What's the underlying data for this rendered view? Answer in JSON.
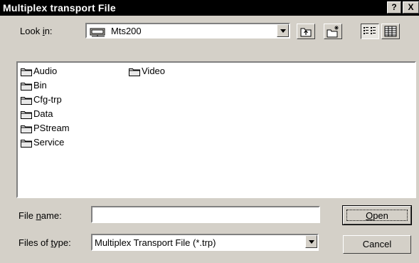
{
  "window": {
    "title": "Multiplex transport File",
    "help_label": "?",
    "close_label": "X"
  },
  "lookin": {
    "label_prefix": "Look ",
    "label_hotkey": "i",
    "label_suffix": "n:",
    "value": "Mts200"
  },
  "toolbar": {
    "icons": [
      "up-folder-icon",
      "new-folder-icon",
      "list-view-icon",
      "details-view-icon"
    ]
  },
  "files": [
    {
      "name": "Audio",
      "icon": "folder-icon"
    },
    {
      "name": "Bin",
      "icon": "folder-icon"
    },
    {
      "name": "Cfg-trp",
      "icon": "folder-icon"
    },
    {
      "name": "Data",
      "icon": "folder-icon"
    },
    {
      "name": "PStream",
      "icon": "folder-icon"
    },
    {
      "name": "Service",
      "icon": "folder-icon"
    },
    {
      "name": "Video",
      "icon": "folder-icon"
    }
  ],
  "filename": {
    "label_prefix": "File ",
    "label_hotkey": "n",
    "label_suffix": "ame:",
    "value": ""
  },
  "filetype": {
    "label_prefix": "Files of ",
    "label_hotkey": "t",
    "label_suffix": "ype:",
    "value": "Multiplex Transport File (*.trp)"
  },
  "buttons": {
    "open_hotkey": "O",
    "open_rest": "pen",
    "cancel": "Cancel"
  }
}
